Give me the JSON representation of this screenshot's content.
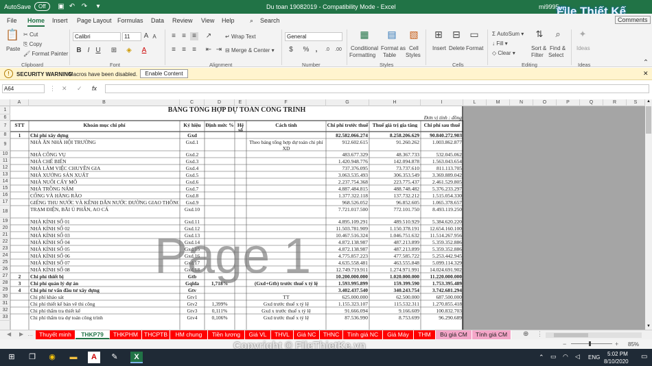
{
  "titlebar": {
    "autosave": "AutoSave",
    "autosave_state": "Off",
    "filename": "Du toan 19082019 - Compatibility Mode - Excel",
    "user": "mi9995"
  },
  "logo": {
    "text": "File Thiết Kế",
    "suffix": ".vn"
  },
  "tabs": [
    "File",
    "Home",
    "Insert",
    "Page Layout",
    "Formulas",
    "Data",
    "Review",
    "View",
    "Help"
  ],
  "search": "Search",
  "share": "Comments",
  "ribbon": {
    "clipboard": {
      "paste": "Paste",
      "cut": "Cut",
      "copy": "Copy",
      "format_painter": "Format Painter",
      "group": "Clipboard"
    },
    "font": {
      "name": "Calibri",
      "size": "11",
      "group": "Font"
    },
    "alignment": {
      "wrap": "Wrap Text",
      "merge": "Merge & Center",
      "group": "Alignment"
    },
    "number": {
      "format": "General",
      "group": "Number"
    },
    "styles": {
      "cond": "Conditional",
      "cond2": "Formatting",
      "fmt_table": "Format as",
      "fmt_table2": "Table",
      "cell_styles": "Cell",
      "cell_styles2": "Styles",
      "group": "Styles"
    },
    "cells": {
      "insert": "Insert",
      "delete": "Delete",
      "format": "Format",
      "group": "Cells"
    },
    "editing": {
      "autosum": "AutoSum",
      "fill": "Fill",
      "clear": "Clear",
      "sort": "Sort &",
      "sort2": "Filter",
      "find": "Find &",
      "find2": "Select",
      "group": "Editing"
    },
    "ideas": {
      "label": "Ideas",
      "group": "Ideas"
    }
  },
  "security": {
    "title": "SECURITY WARNING",
    "message": "Macros have been disabled.",
    "button": "Enable Content"
  },
  "formula_bar": {
    "namebox": "A64",
    "fx": "fx",
    "value": ""
  },
  "columns": [
    "A",
    "B",
    "C",
    "D",
    "E",
    "F",
    "G",
    "H",
    "I",
    "L",
    "M",
    "N",
    "O",
    "P",
    "Q",
    "R",
    "S"
  ],
  "rows": [
    "1",
    "6",
    "7",
    "8",
    "9",
    "10",
    "11",
    "12",
    "13",
    "14",
    "15",
    "16",
    "17",
    "18",
    "19",
    "20",
    "21",
    "22",
    "23",
    "24",
    "25",
    "26",
    "27",
    "28",
    "29",
    "30",
    "31",
    "32",
    "33"
  ],
  "sheet": {
    "title": "BẢNG TỔNG HỢP DỰ TOÁN CÔNG TRÌNH",
    "unit": "Đơn vị tính : đồng",
    "headers": {
      "stt": "STT",
      "item": "Khoản mục chi phí",
      "code": "Ký hiệu",
      "rate": "Định mức %",
      "coef": "Hệ số",
      "method": "Cách tính",
      "pre": "Chi phí trước thuế",
      "vat": "Thuế giá trị gia tăng",
      "post": "Chi phí sau thuế"
    },
    "rows": [
      {
        "stt": "1",
        "name": "Chi phí xây dựng",
        "code": "Gxd",
        "rate": "",
        "method": "",
        "pre": "82.582.066.274",
        "vat": "8.258.206.629",
        "post": "90.840.272.903",
        "bold": true
      },
      {
        "stt": "",
        "name": "NHÀ ĂN NHÀ HỘI TRƯỜNG",
        "code": "Gxd.1",
        "rate": "",
        "method": "Theo bảng tổng hợp dự toán chi phí XD",
        "pre": "912.602.615",
        "vat": "91.260.262",
        "post": "1.003.862.877"
      },
      {
        "stt": "",
        "name": "NHÀ CÔNG VỤ",
        "code": "Gxd.2",
        "rate": "",
        "method": "",
        "pre": "483.677.329",
        "vat": "48.367.733",
        "post": "532.045.062"
      },
      {
        "stt": "",
        "name": "NHÀ CHẾ BIẾN",
        "code": "Gxd.3",
        "rate": "",
        "method": "",
        "pre": "1.420.948.776",
        "vat": "142.094.878",
        "post": "1.563.043.654"
      },
      {
        "stt": "",
        "name": "NHÀ LÀM VIỆC CHUYÊN GIA",
        "code": "Gxd.4",
        "rate": "",
        "method": "",
        "pre": "737.376.095",
        "vat": "73.737.610",
        "post": "811.113.705"
      },
      {
        "stt": "",
        "name": "NHÀ XƯỞNG SẢN XUẤT",
        "code": "Gxd.5",
        "rate": "",
        "method": "",
        "pre": "3.063.535.493",
        "vat": "306.353.549",
        "post": "3.369.889.042"
      },
      {
        "stt": "",
        "name": "NHÀ NUÔI CẤY MÔ",
        "code": "Gxd.6",
        "rate": "",
        "method": "",
        "pre": "2.237.754.368",
        "vat": "223.775.437",
        "post": "2.461.529.805"
      },
      {
        "stt": "",
        "name": "NHÀ TRỒNG NẤM",
        "code": "Gxd.7",
        "rate": "",
        "method": "",
        "pre": "4.887.484.815",
        "vat": "488.748.482",
        "post": "5.376.233.297"
      },
      {
        "stt": "",
        "name": "CỔNG VÀ HÀNG RÀO",
        "code": "Gxd.8",
        "rate": "",
        "method": "",
        "pre": "1.377.322.118",
        "vat": "137.732.212",
        "post": "1.515.054.330"
      },
      {
        "stt": "",
        "name": "GIẾNG THU NƯỚC VÀ KÊNH DẪN NƯỚC ĐƯỜNG GIAO THÔNG",
        "code": "Gxd.9",
        "rate": "",
        "method": "",
        "pre": "968.526.052",
        "vat": "96.852.605",
        "post": "1.065.378.657"
      },
      {
        "stt": "",
        "name": "TRẠM ĐIỆN, BÃI Ủ PHÂN, AO CÁ",
        "code": "Gxd.10",
        "rate": "",
        "method": "",
        "pre": "7.721.017.500",
        "vat": "772.101.750",
        "post": "8.493.119.250"
      },
      {
        "stt": "",
        "name": "NHÀ KÍNH SỐ 01",
        "code": "Gxd.11",
        "rate": "",
        "method": "",
        "pre": "4.895.109.291",
        "vat": "489.510.929",
        "post": "5.384.620.220"
      },
      {
        "stt": "",
        "name": "NHÀ KÍNH SỐ 02",
        "code": "Gxd.12",
        "rate": "",
        "method": "",
        "pre": "11.503.781.909",
        "vat": "1.150.378.191",
        "post": "12.654.160.100"
      },
      {
        "stt": "",
        "name": "NHÀ KÍNH SỐ 03",
        "code": "Gxd.13",
        "rate": "",
        "method": "",
        "pre": "10.467.516.324",
        "vat": "1.046.751.632",
        "post": "11.514.267.956"
      },
      {
        "stt": "",
        "name": "NHÀ KÍNH SỐ 04",
        "code": "Gxd.14",
        "rate": "",
        "method": "",
        "pre": "4.872.138.987",
        "vat": "487.213.899",
        "post": "5.359.352.886"
      },
      {
        "stt": "",
        "name": "NHÀ KÍNH SỐ 05",
        "code": "Gxd.15",
        "rate": "",
        "method": "",
        "pre": "4.872.138.987",
        "vat": "487.213.899",
        "post": "5.359.352.886"
      },
      {
        "stt": "",
        "name": "NHÀ KÍNH SỐ 06",
        "code": "Gxd.16",
        "rate": "",
        "method": "",
        "pre": "4.775.857.223",
        "vat": "477.585.722",
        "post": "5.253.442.945"
      },
      {
        "stt": "",
        "name": "NHÀ KÍNH SỐ 07",
        "code": "Gxd.17",
        "rate": "",
        "method": "",
        "pre": "4.635.558.481",
        "vat": "463.555.848",
        "post": "5.099.114.329"
      },
      {
        "stt": "",
        "name": "NHÀ KÍNH SỐ 08",
        "code": "Gxd.18",
        "rate": "",
        "method": "",
        "pre": "12.749.719.911",
        "vat": "1.274.971.991",
        "post": "14.024.691.902"
      },
      {
        "stt": "2",
        "name": "Chi phí thiết bị",
        "code": "Gtb",
        "rate": "",
        "method": "",
        "pre": "10.200.000.000",
        "vat": "1.020.000.000",
        "post": "11.220.000.000",
        "bold": true
      },
      {
        "stt": "3",
        "name": "Chi phí quản lý dự án",
        "code": "Gqlda",
        "rate": "1,718%",
        "method": "(Gxd+Gtb) trước thuế x tỷ lệ",
        "pre": "1.593.995.899",
        "vat": "159.399.590",
        "post": "1.753.395.489",
        "bold": true
      },
      {
        "stt": "4",
        "name": "Chi phí tư vấn đầu tư xây dựng",
        "code": "Gtv",
        "rate": "",
        "method": "",
        "pre": "3.402.437.540",
        "vat": "340.243.754",
        "post": "3.742.681.294",
        "bold": true
      },
      {
        "stt": "",
        "name": "Chi phí khảo sát",
        "code": "Gtv1",
        "rate": "",
        "method": "TT",
        "pre": "625.000.000",
        "vat": "62.500.000",
        "post": "687.500.000"
      },
      {
        "stt": "",
        "name": "Chi phí thiết kế bản vẽ thi công",
        "code": "Gtv2",
        "rate": "1,399%",
        "method": "Gxd trước thuế x tỷ lệ",
        "pre": "1.155.323.107",
        "vat": "115.532.311",
        "post": "1.270.855.418"
      },
      {
        "stt": "",
        "name": "Chi phí thẩm tra thiết kế",
        "code": "Gtv3",
        "rate": "0,111%",
        "method": "Gxd x trước thuế x tỷ lệ",
        "pre": "91.666.094",
        "vat": "9.166.609",
        "post": "100.832.703"
      },
      {
        "stt": "",
        "name": "Chi phí thẩm tra dự toán công trình",
        "code": "Gtv4",
        "rate": "0,106%",
        "method": "Gxd trước thuế x tỷ lệ",
        "pre": "87.536.990",
        "vat": "8.753.699",
        "post": "96.290.689"
      }
    ]
  },
  "watermark": "Page 1",
  "sheet_tabs": [
    "Thuyết minh",
    "THKP79",
    "THKPHM",
    "THCPTB",
    "HM chung",
    "Tiền lương",
    "Giá VL",
    "THVL",
    "Giá NC",
    "THNC",
    "Tính giá NC",
    "Giá Máy",
    "THM",
    "Bù giá CM",
    "Tính giá CM"
  ],
  "status": {
    "zoom": "85%"
  },
  "copyright": "Copyright © FileThietKe.vn",
  "taskbar": {
    "time": "5:02 PM",
    "date": "8/10/2020",
    "lang": "ENG"
  }
}
